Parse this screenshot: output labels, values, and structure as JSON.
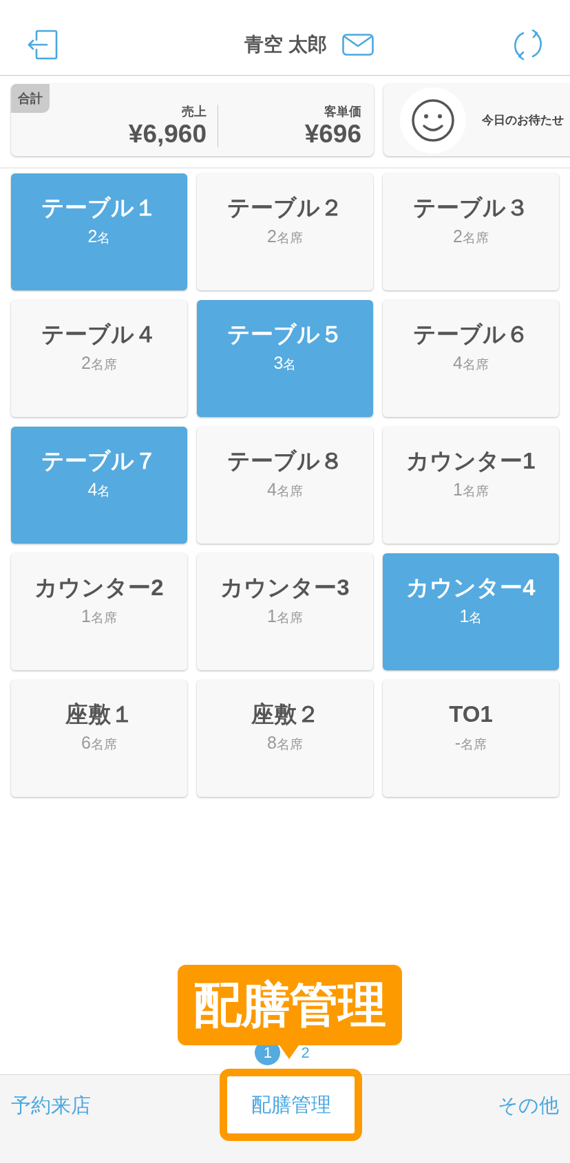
{
  "header": {
    "user_name": "青空 太郎"
  },
  "summary": {
    "badge": "合計",
    "stats": [
      {
        "label": "売上",
        "value": "¥6,960"
      },
      {
        "label": "客単価",
        "value": "¥696"
      }
    ],
    "notice": {
      "text": "今日のお待たせ"
    }
  },
  "tables": [
    {
      "name": "テーブル１",
      "count": "2",
      "unit": "名",
      "occupied": true
    },
    {
      "name": "テーブル２",
      "count": "2",
      "unit": "名席",
      "occupied": false
    },
    {
      "name": "テーブル３",
      "count": "2",
      "unit": "名席",
      "occupied": false
    },
    {
      "name": "テーブル４",
      "count": "2",
      "unit": "名席",
      "occupied": false
    },
    {
      "name": "テーブル５",
      "count": "3",
      "unit": "名",
      "occupied": true
    },
    {
      "name": "テーブル６",
      "count": "4",
      "unit": "名席",
      "occupied": false
    },
    {
      "name": "テーブル７",
      "count": "4",
      "unit": "名",
      "occupied": true
    },
    {
      "name": "テーブル８",
      "count": "4",
      "unit": "名席",
      "occupied": false
    },
    {
      "name": "カウンター1",
      "count": "1",
      "unit": "名席",
      "occupied": false
    },
    {
      "name": "カウンター2",
      "count": "1",
      "unit": "名席",
      "occupied": false
    },
    {
      "name": "カウンター3",
      "count": "1",
      "unit": "名席",
      "occupied": false
    },
    {
      "name": "カウンター4",
      "count": "1",
      "unit": "名",
      "occupied": true
    },
    {
      "name": "座敷１",
      "count": "6",
      "unit": "名席",
      "occupied": false
    },
    {
      "name": "座敷２",
      "count": "8",
      "unit": "名席",
      "occupied": false
    },
    {
      "name": "TO1",
      "count": "-",
      "unit": "名席",
      "occupied": false
    }
  ],
  "pagination": [
    {
      "label": "1",
      "selected": true
    },
    {
      "label": "2",
      "selected": false
    }
  ],
  "callout": {
    "text": "配膳管理"
  },
  "tabs": [
    {
      "label": "予約来店",
      "highlighted": false
    },
    {
      "label": "配膳管理",
      "highlighted": true
    },
    {
      "label": "その他",
      "highlighted": false
    }
  ]
}
